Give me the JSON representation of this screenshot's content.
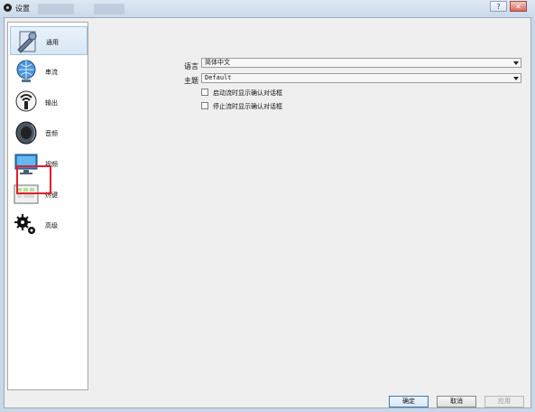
{
  "window": {
    "title": "设置",
    "controls": {
      "help": "?",
      "close": "✕"
    }
  },
  "sidebar": {
    "items": [
      {
        "label": "通用",
        "icon": "wrench-document-icon",
        "selected": true
      },
      {
        "label": "串流",
        "icon": "globe-network-icon",
        "selected": false
      },
      {
        "label": "输出",
        "icon": "broadcast-icon",
        "selected": false
      },
      {
        "label": "音频",
        "icon": "speaker-icon",
        "selected": false
      },
      {
        "label": "视频",
        "icon": "monitor-icon",
        "selected": false
      },
      {
        "label": "热键",
        "icon": "keyboard-icon",
        "selected": false
      },
      {
        "label": "高级",
        "icon": "gears-icon",
        "selected": false
      }
    ]
  },
  "general": {
    "language_label": "语言",
    "language_value": "简体中文",
    "theme_label": "主题",
    "theme_value": "Default",
    "startup_confirm_label": "启动流时显示确认对话框",
    "stop_confirm_label": "停止流时显示确认对话框"
  },
  "footer": {
    "ok_label": "确定",
    "cancel_label": "取消",
    "apply_label": "应用"
  },
  "colors": {
    "highlight_red": "#e01f2b",
    "selected_blue": "#d8e8f7"
  }
}
